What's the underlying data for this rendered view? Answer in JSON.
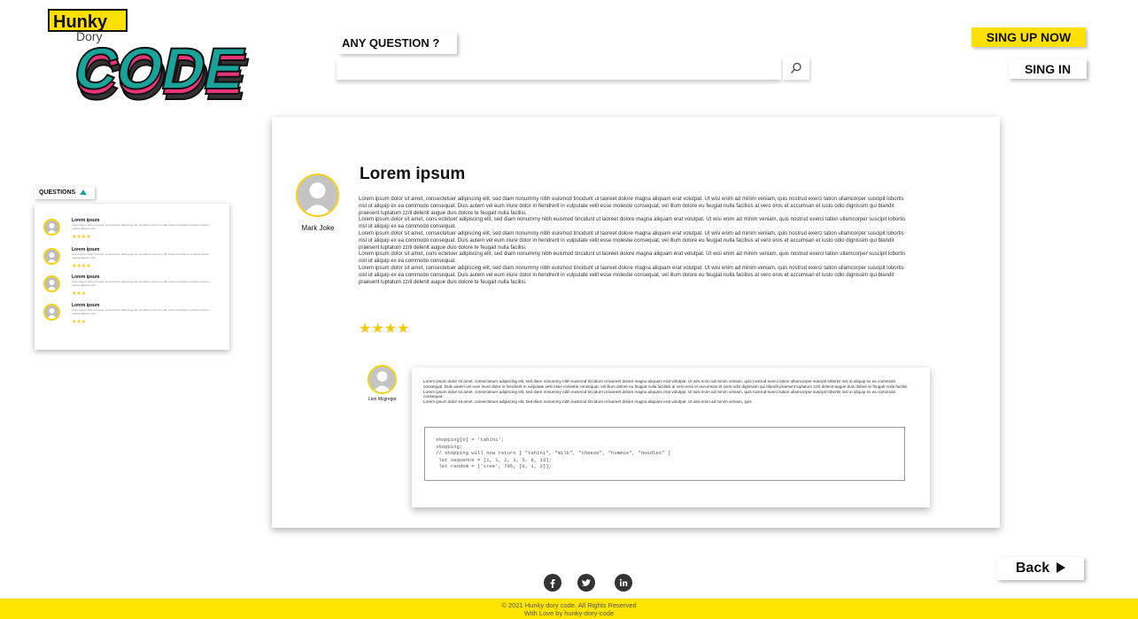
{
  "logo": {
    "line1": "Hunky",
    "line2": "Dory",
    "line3": "CODE"
  },
  "header": {
    "question_label": "ANY QUESTION ?",
    "search_placeholder": "",
    "signup": "SING UP NOW",
    "signin": "SING IN"
  },
  "sidebar": {
    "tab_label": "QUESTIONS",
    "items": [
      {
        "title": "Lorem ipsum",
        "text": "Lorem ipsum dolor sit amet, consectetuer adipiscing elit, sed diam nonummy nibh euismod tincidunt ut laoreet dolore magna aliquam erat",
        "stars": "★★★★"
      },
      {
        "title": "Lorem ipsum",
        "text": "Lorem ipsum dolor sit amet, consectetuer adipiscing elit, sed diam nonummy nibh euismod tincidunt ut laoreet dolore magna aliquam erat",
        "stars": "★★★★"
      },
      {
        "title": "Lorem ipsum",
        "text": "Lorem ipsum dolor sit amet, consectetuer adipiscing elit, sed diam nonummy nibh euismod tincidunt ut laoreet dolore magna aliquam erat",
        "stars": "★★★"
      },
      {
        "title": "Lorem ipsum",
        "text": "Lorem ipsum dolor sit amet, consectetuer adipiscing elit, sed diam nonummy nibh euismod tincidunt ut laoreet dolore magna aliquam erat",
        "stars": "★★★"
      }
    ]
  },
  "post": {
    "author": "Mark Joke",
    "title": "Lorem ipsum",
    "paragraphs": [
      "Lorem ipsum dolor sit amet, consectetuer adipiscing elit, sed diam nonummy nibh euismod tincidunt ut laoreet dolore magna aliquam erat volutpat. Ut wisi enim ad minim veniam, quis nostrud exerci tation ullamcorper suscipit lobortis nisl ut aliquip ex ea commodo consequat. Duis autem vel eum iriure dolor in hendrerit in vulputate velit esse molestie consequat, vel illum dolore eu feugiat nulla facilisis at vero eros et accumsan et iusto odio dignissim qui blandit praesent luptatum zzril delenit augue duis dolore te feugait nulla facilisi.",
      "Lorem ipsum dolor sit amet, cons ectetuer adipiscing elit, sed diam nonummy nibh euismod tincidunt ut laoreet dolore magna aliquam erat volutpat. Ut wisi enim ad minim veniam, quis nostrud exerci tation ullamcorper suscipit lobortis nisl ut aliquip ex ea commodo consequat.",
      "Lorem ipsum dolor sit amet, consectetuer adipiscing elit, sed diam nonummy nibh euismod tincidunt ut laoreet dolore magna aliquam erat volutpat. Ut wisi enim ad minim veniam, quis nostrud exerci tation ullamcorper suscipit lobortis nisl ut aliquip ex ea commodo consequat. Duis autem vel eum iriure dolor in hendrerit in vulputate velit esse molestie consequat, vel illum dolore eu feugiat nulla facilisis at vero eros et accumsan et iusto odio dignissim qui blandit praesent luptatum zzril delenit augue duis dolore te feugait nulla facilisi.",
      "Lorem ipsum dolor sit amet, cons ectetuer adipiscing elit, sed diam nonummy nibh euismod tincidunt ut laoreet dolore magna aliquam erat volutpat. Ut wisi enim ad minim veniam, quis nostrud exerci tation ullamcorper suscipit lobortis nisl ut aliquip ex ea commodo consequat.",
      "Lorem ipsum dolor sit amet, consectetuer adipiscing elit, sed diam nonummy nibh euismod tincidunt ut laoreet dolore magna aliquam erat volutpat. Ut wisi enim ad minim veniam, quis nostrud exerci tation ullamcorper suscipit lobortis nisl ut aliquip ex ea commodo consequat. Duis autem vel eum iriure dolor in hendrerit in vulputate velit esse molestie consequat, vel illum dolore eu feugiat nulla facilisis at vero eros et accumsan et iusto odio dignissim qui blandit praesent luptatum zzril delenit augue duis dolore te feugait nulla facilisi."
    ],
    "stars": "★★★★"
  },
  "reply": {
    "author": "Lion Mcgregor",
    "paragraphs": [
      "Lorem ipsum dolor sit amet, consectetuer adipiscing elit, sed diam nonummy nibh euismod tincidunt ut laoreet dolore magna aliquam erat volutpat. Ut wisi enim ad minim veniam, quis nostrud exerci tation ullamcorper suscipit lobortis nisl ut aliquip ex ea commodo consequat. Duis autem vel eum iriure dolor in hendrerit in vulputate velit esse molestie consequat, vel illum dolore eu feugiat nulla facilisis at vero eros et accumsan et iusto odio dignissim qui blandit praesent luptatum zzril delenit augue duis dolore te feugait nulla facilisi.",
      "Lorem ipsum dolor sit amet, consectetuer adipiscing elit, sed diam nonummy nibh euismod tincidunt ut laoreet dolore magna aliquam erat volutpat. Ut wisi enim ad minim veniam, quis nostrud exerci tation ullamcorper suscipit lobortis nisl ut aliquip ex ea commodo consequat.",
      "Lorem ipsum dolor sit amet, consectetuer adipiscing elit, sed diam nonummy nibh euismod tincidunt ut laoreet dolore magna aliquam erat volutpat. Ut wisi enim ad minim veniam, quis"
    ],
    "code": "shopping[0] = 'tahini';\nshopping;\n// shopping will now return [ \"tahini\", \"milk\", \"cheese\", \"hummus\", \"noodles\" ]\n let sequence = [1, 1, 2, 3, 5, 8, 13];\n let random = ['tree', 795, [0, 1, 2]];"
  },
  "back_label": "Back",
  "social_icons": [
    "facebook-icon",
    "twitter-icon",
    "linkedin-icon"
  ],
  "footer": {
    "line1": "© 2021 Hunky dory code. All Rights Reserved",
    "line2": "With Love by hunky-dory-code"
  },
  "colors": {
    "accent": "#ffe400",
    "avatar_ring": "#f4d21a",
    "teal": "#1aa39a",
    "pink": "#e8357a"
  }
}
